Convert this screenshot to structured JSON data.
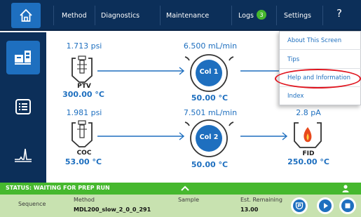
{
  "nav": {
    "tabs": [
      {
        "label": "Method"
      },
      {
        "label": "Diagnostics"
      },
      {
        "label": "Maintenance"
      },
      {
        "label": "Logs",
        "badge": "3"
      },
      {
        "label": "Settings"
      }
    ],
    "help_label": "?"
  },
  "menu": {
    "items": [
      {
        "label": "About This Screen"
      },
      {
        "label": "Tips"
      },
      {
        "label": "Help and Information",
        "highlighted": true
      },
      {
        "label": "Index"
      }
    ]
  },
  "flow": {
    "row1": {
      "inlet_pressure": "1.713 psi",
      "inlet_name": "PTV",
      "inlet_temp": "300.00 °C",
      "flow_rate": "6.500 mL/min",
      "column_name": "Col 1",
      "column_temp": "50.00 °C"
    },
    "row2": {
      "inlet_pressure": "1.981 psi",
      "inlet_name": "COC",
      "inlet_temp": "53.00 °C",
      "flow_rate": "7.501 mL/min",
      "column_name": "Col 2",
      "column_temp": "50.00 °C",
      "detector_signal": "2.8 pA",
      "detector_name": "FID",
      "detector_temp": "250.00 °C"
    }
  },
  "status": {
    "text": "STATUS: WAITING FOR PREP RUN",
    "sequence_label": "Sequence",
    "method_label": "Method",
    "method_value": "MDL200_slow_2_0_0_291",
    "sample_label": "Sample",
    "remaining_label": "Est. Remaining",
    "remaining_value": "13.00"
  },
  "colors": {
    "navy": "#0c2f59",
    "accent_blue": "#1e6fbf",
    "status_green": "#46b82e",
    "bottom_green": "#c8e2b0",
    "highlight_red": "#e0141e"
  }
}
